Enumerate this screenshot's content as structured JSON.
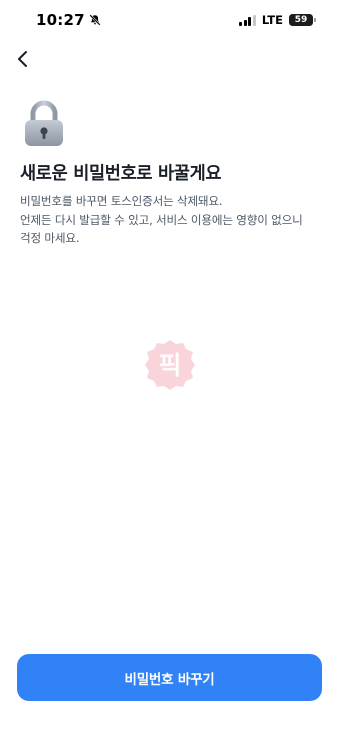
{
  "status_bar": {
    "time": "10:27",
    "network": "LTE",
    "battery": "59",
    "icons": [
      "bell-slash-icon",
      "signal-icon",
      "battery-icon"
    ]
  },
  "nav": {
    "back_icon": "chevron-left-icon"
  },
  "header": {
    "icon": "lock-icon",
    "title": "새로운 비밀번호로 바꿀게요"
  },
  "description": {
    "line1": "비밀번호를 바꾸면 토스인증서는 삭제돼요.",
    "line2": "언제든 다시 발급할 수 있고, 서비스 이용에는 영향이 없으니",
    "line3": "걱정 마세요."
  },
  "watermark": {
    "text": "픽"
  },
  "footer": {
    "button_label": "비밀번호 바꾸기"
  },
  "colors": {
    "accent": "#3182f6",
    "title": "#191f28",
    "body_text": "#4e5968",
    "watermark": "#f5a3ad"
  }
}
